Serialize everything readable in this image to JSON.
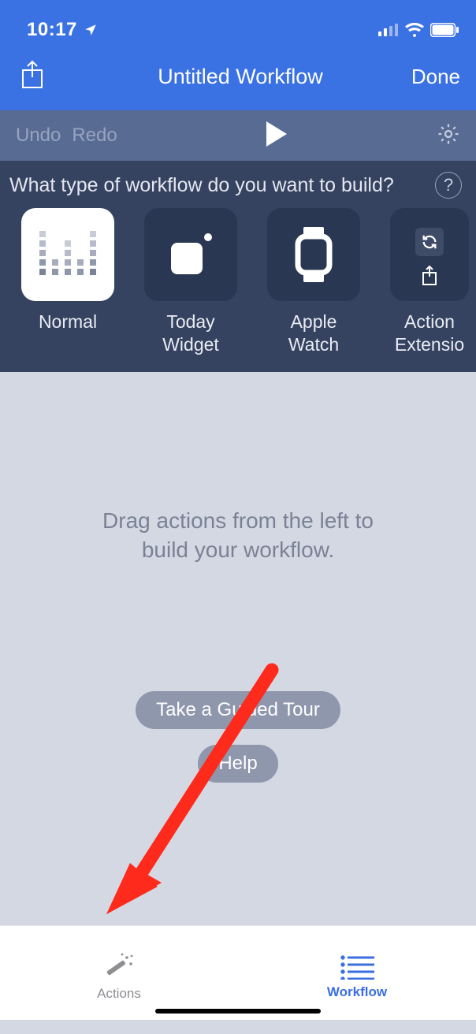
{
  "statusbar": {
    "time": "10:17"
  },
  "navbar": {
    "title": "Untitled Workflow",
    "done": "Done"
  },
  "toolbar": {
    "undo": "Undo",
    "redo": "Redo"
  },
  "type_panel": {
    "question": "What type of workflow do you want to build?",
    "items": [
      {
        "label": "Normal"
      },
      {
        "label": "Today Widget"
      },
      {
        "label": "Apple Watch"
      },
      {
        "label": "Action Extensio"
      }
    ]
  },
  "canvas": {
    "message_line1": "Drag actions from the left to",
    "message_line2": "build your workflow.",
    "tour_btn": "Take a Guided Tour",
    "help_btn": "Help"
  },
  "tabs": {
    "actions": "Actions",
    "workflow": "Workflow"
  }
}
